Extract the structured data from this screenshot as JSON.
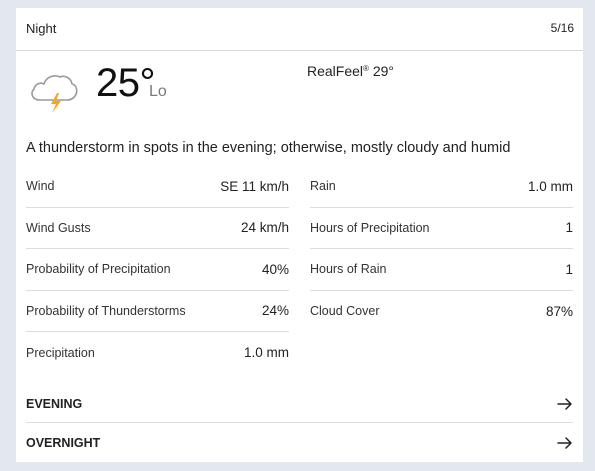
{
  "header": {
    "title": "Night",
    "date": "5/16"
  },
  "current": {
    "icon": "thunderstorm-cloud-icon",
    "temperature": "25°",
    "temp_label": "Lo",
    "realfeel_label": "RealFeel",
    "realfeel_mark": "®",
    "realfeel_value": "29°",
    "phrase": "A thunderstorm in spots in the evening; otherwise, mostly cloudy and humid"
  },
  "details_left": [
    {
      "label": "Wind",
      "value": "SE 11 km/h"
    },
    {
      "label": "Wind Gusts",
      "value": "24 km/h"
    },
    {
      "label": "Probability of Precipitation",
      "value": "40%"
    },
    {
      "label": "Probability of Thunderstorms",
      "value": "24%"
    },
    {
      "label": "Precipitation",
      "value": "1.0 mm"
    }
  ],
  "details_right": [
    {
      "label": "Rain",
      "value": "1.0 mm"
    },
    {
      "label": "Hours of Precipitation",
      "value": "1"
    },
    {
      "label": "Hours of Rain",
      "value": "1"
    },
    {
      "label": "Cloud Cover",
      "value": "87%"
    }
  ],
  "links": [
    {
      "label": "EVENING",
      "icon": "arrow-right-icon"
    },
    {
      "label": "OVERNIGHT",
      "icon": "arrow-right-icon"
    }
  ],
  "colors": {
    "bolt": "#f5a623",
    "cloud_stroke": "#9a9a9a",
    "background": "#e3e8ef"
  }
}
